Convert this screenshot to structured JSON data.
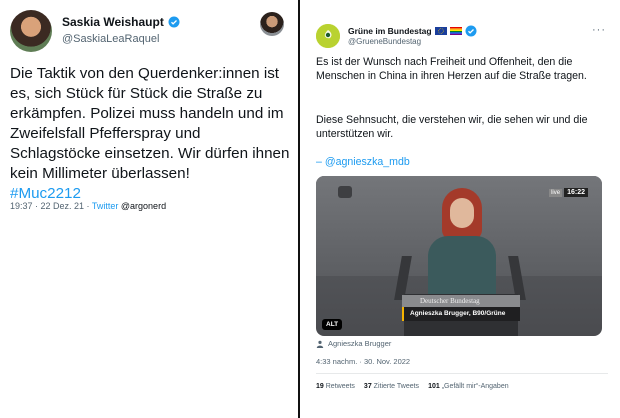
{
  "left_tweet": {
    "author_name": "Saskia Weishaupt",
    "handle": "@SaskiaLeaRaquel",
    "text": "Die Taktik von den Querdenker:innen ist es, sich Stück für Stück die Straße zu erkämpfen. Polizei muss handeln und im Zweifelsfall Pfefferspray und Schlagstöcke einsetzen. Wir dürfen ihnen kein Millimeter überlassen!",
    "hashtag": "#Muc2212",
    "time": "19:37 · 22 Dez. 21 · ",
    "via": "Twitter",
    "via_user": " @argonerd"
  },
  "right_tweet": {
    "author_name": "Grüne im Bundestag",
    "handle": "@GrueneBundestag",
    "more": "···",
    "text1": "Es ist der Wunsch nach Freiheit und Offenheit, den die Menschen in China in ihren Herzen auf die Straße tragen.",
    "text2": "Diese Sehnsucht, die verstehen wir, die sehen wir und die unterstützen wir.",
    "mention": "– @agnieszka_mdb",
    "video": {
      "live_tag": "live",
      "clock": "16:22",
      "lower_third_org": "Deutscher Bundestag",
      "lower_third_speaker": "Agnieszka Brugger, B90/Grüne",
      "alt_label": "ALT"
    },
    "credit": "Agnieszka Brugger",
    "timestamp": "4:33 nachm. · 30. Nov. 2022",
    "stats": {
      "retweets_count": "19",
      "retweets_label": " Retweets",
      "quotes_count": "37",
      "quotes_label": " Zitierte Tweets",
      "likes_count": "101",
      "likes_label": " „Gefällt mir“-Angaben"
    }
  },
  "colors": {
    "link": "#1d9bf0",
    "secondary_text": "#536471",
    "divider": "#111111"
  }
}
